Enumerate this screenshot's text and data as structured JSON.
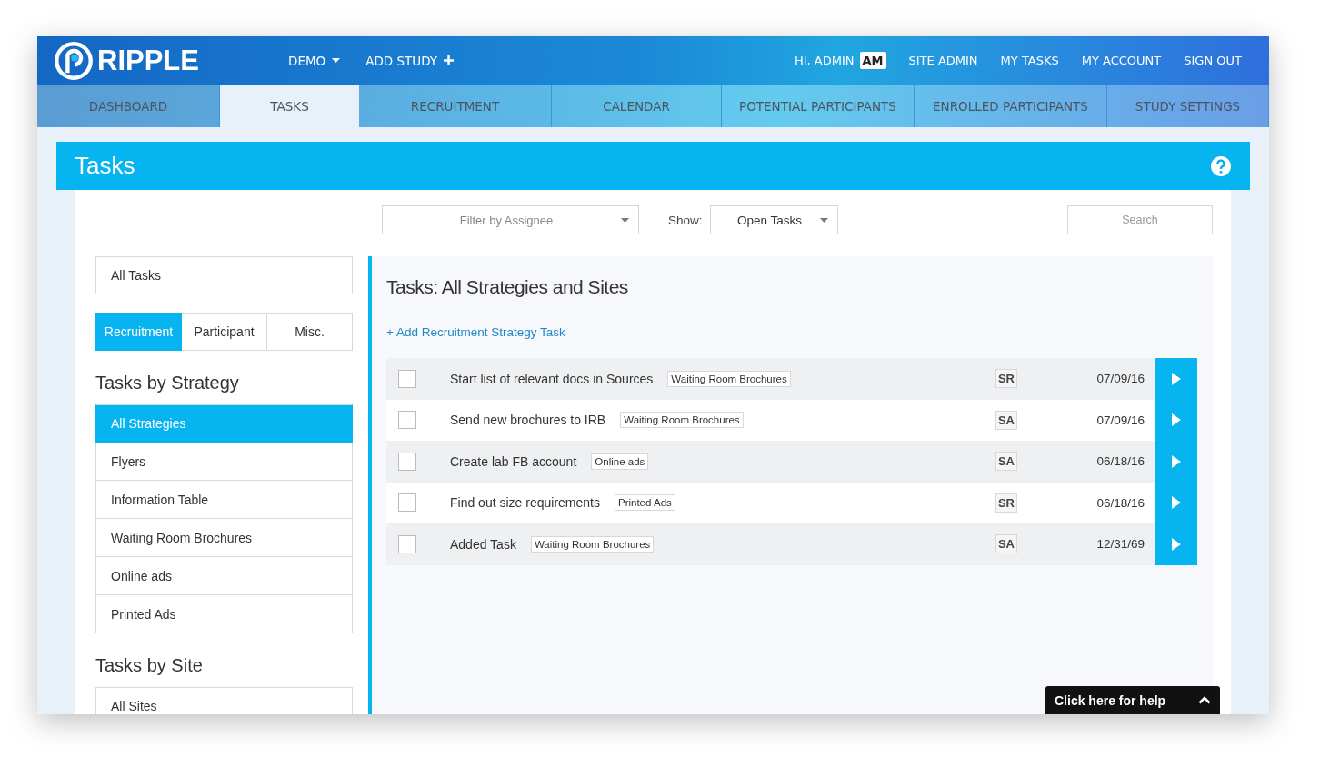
{
  "header": {
    "logo": "RIPPLE",
    "menus": [
      {
        "label": "DEMO",
        "kind": "dropdown"
      },
      {
        "label": "ADD STUDY",
        "kind": "add"
      }
    ],
    "greeting": "HI, ADMIN",
    "initials": "AM",
    "links": [
      "SITE ADMIN",
      "MY TASKS",
      "MY ACCOUNT",
      "SIGN OUT"
    ]
  },
  "tabs": [
    {
      "label": "DASHBOARD",
      "selected": false
    },
    {
      "label": "TASKS",
      "selected": true
    },
    {
      "label": "RECRUITMENT",
      "selected": false
    },
    {
      "label": "CALENDAR",
      "selected": false
    },
    {
      "label": "POTENTIAL PARTICIPANTS",
      "selected": false
    },
    {
      "label": "ENROLLED PARTICIPANTS",
      "selected": false
    },
    {
      "label": "STUDY SETTINGS",
      "selected": false
    }
  ],
  "page_title": "Tasks",
  "filters": {
    "assignee_placeholder": "Filter by Assignee",
    "show_label": "Show:",
    "show_value": "Open Tasks",
    "search_placeholder": "Search"
  },
  "sidebar": {
    "all_tasks": "All Tasks",
    "categories": [
      {
        "label": "Recruitment",
        "selected": true
      },
      {
        "label": "Participant",
        "selected": false
      },
      {
        "label": "Misc.",
        "selected": false
      }
    ],
    "strategy_heading": "Tasks by Strategy",
    "strategies": [
      {
        "label": "All Strategies",
        "selected": true
      },
      {
        "label": "Flyers",
        "selected": false
      },
      {
        "label": "Information Table",
        "selected": false
      },
      {
        "label": "Waiting Room Brochures",
        "selected": false
      },
      {
        "label": "Online ads",
        "selected": false
      },
      {
        "label": "Printed Ads",
        "selected": false
      }
    ],
    "site_heading": "Tasks by Site",
    "sites": [
      {
        "label": "All Sites",
        "selected": false
      }
    ]
  },
  "tasks": {
    "title": "Tasks: All Strategies and Sites",
    "add_link": "+ Add Recruitment Strategy Task",
    "rows": [
      {
        "title": "Start list of relevant docs in Sources",
        "tag": "Waiting Room Brochures",
        "assignee": "SR",
        "date": "07/09/16",
        "checked": false
      },
      {
        "title": "Send new brochures to IRB",
        "tag": "Waiting Room Brochures",
        "assignee": "SA",
        "date": "07/09/16",
        "checked": false
      },
      {
        "title": "Create lab FB account",
        "tag": "Online ads",
        "assignee": "SA",
        "date": "06/18/16",
        "checked": false
      },
      {
        "title": "Find out size requirements",
        "tag": "Printed Ads",
        "assignee": "SR",
        "date": "06/18/16",
        "checked": false
      },
      {
        "title": "Added Task",
        "tag": "Waiting Room Brochures",
        "assignee": "SA",
        "date": "12/31/69",
        "checked": false
      }
    ]
  },
  "help_button": "Click here for help"
}
